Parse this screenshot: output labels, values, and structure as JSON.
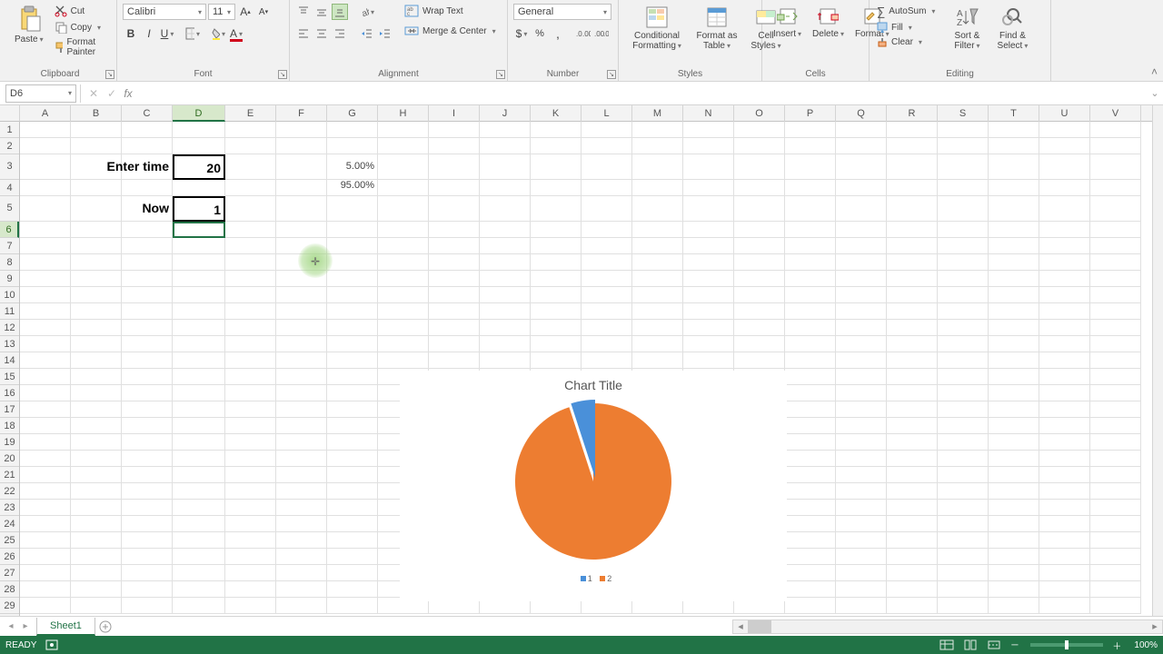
{
  "ribbon": {
    "groups": {
      "clipboard": {
        "label": "Clipboard",
        "paste": "Paste",
        "cut": "Cut",
        "copy": "Copy",
        "format_painter": "Format Painter"
      },
      "font": {
        "label": "Font",
        "name": "Calibri",
        "size": "11"
      },
      "alignment": {
        "label": "Alignment",
        "wrap": "Wrap Text",
        "merge": "Merge & Center"
      },
      "number": {
        "label": "Number",
        "format": "General"
      },
      "styles": {
        "label": "Styles",
        "cond": "Conditional Formatting",
        "table": "Format as Table",
        "cell": "Cell Styles"
      },
      "cells": {
        "label": "Cells",
        "insert": "Insert",
        "delete": "Delete",
        "format": "Format"
      },
      "editing": {
        "label": "Editing",
        "autosum": "AutoSum",
        "fill": "Fill",
        "clear": "Clear",
        "sort": "Sort & Filter",
        "find": "Find & Select"
      }
    }
  },
  "namebox": "D6",
  "grid": {
    "cols": [
      "A",
      "B",
      "C",
      "D",
      "E",
      "F",
      "G",
      "H",
      "I",
      "J",
      "K",
      "L",
      "M",
      "N",
      "O",
      "P",
      "Q",
      "R",
      "S",
      "T",
      "U",
      "V"
    ],
    "sel_col": "D",
    "sel_row": 6,
    "row_count": 29,
    "tall_rows": [
      3,
      5
    ],
    "cells": {
      "C3": "Enter time",
      "D3": "20",
      "G3": "5.00%",
      "C5": "Now",
      "D5": "1",
      "G4": "95.00%"
    }
  },
  "chart_data": {
    "type": "pie",
    "title": "Chart Title",
    "series": [
      {
        "name": "1",
        "value": 5,
        "color": "#4a90d9"
      },
      {
        "name": "2",
        "value": 95,
        "color": "#ed7d31"
      }
    ],
    "legend": [
      "1",
      "2"
    ]
  },
  "sheet_tab": "Sheet1",
  "status": {
    "ready": "READY",
    "zoom": "100%"
  }
}
